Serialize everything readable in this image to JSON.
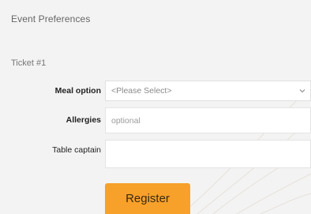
{
  "form": {
    "section_title": "Event Preferences",
    "ticket_label": "Ticket #1",
    "meal": {
      "label": "Meal option",
      "selected": "<Please Select>"
    },
    "allergies": {
      "label": "Allergies",
      "placeholder": "optional",
      "value": ""
    },
    "table_captain": {
      "label": "Table captain",
      "value": ""
    },
    "register_label": "Register"
  },
  "colors": {
    "background": "#f3f3f3",
    "register_button": "#f7a12a"
  },
  "icons": {
    "select_arrow": "chevron-down-icon"
  }
}
